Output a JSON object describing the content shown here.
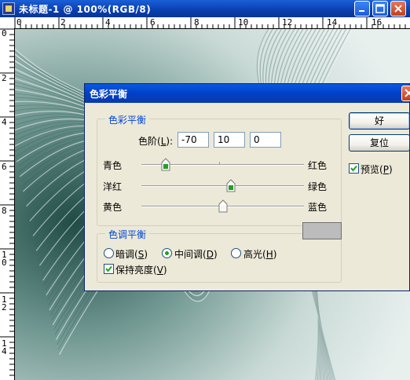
{
  "window": {
    "title": "未标题-1 @ 100%(RGB/8)"
  },
  "rulers": {
    "top": [
      "0",
      "2",
      "4",
      "6",
      "8",
      "10",
      "12",
      "14",
      "16"
    ],
    "left": [
      "0",
      "2",
      "4",
      "6",
      "8",
      "1",
      "0",
      "1",
      "2",
      "1",
      "4"
    ]
  },
  "dialog": {
    "title": "色彩平衡",
    "balance_group": {
      "label": "色彩平衡",
      "levels_label": "色阶(",
      "levels_key": "L",
      "levels_label_end": "):",
      "levels": [
        "-70",
        "10",
        "0"
      ],
      "sliders": [
        {
          "left": "青色",
          "right": "红色",
          "value": -70
        },
        {
          "left": "洋红",
          "right": "绿色",
          "value": 10
        },
        {
          "left": "黄色",
          "right": "蓝色",
          "value": 0
        }
      ]
    },
    "tone_group": {
      "label": "色调平衡",
      "shadows": {
        "text": "暗调(",
        "key": "S",
        "end": ")"
      },
      "midtones": {
        "text": "中间调(",
        "key": "D",
        "end": ")",
        "selected": true
      },
      "highlights": {
        "text": "高光(",
        "key": "H",
        "end": ")"
      },
      "preserve": {
        "text": "保持亮度(",
        "key": "V",
        "end": ")",
        "checked": true
      }
    },
    "ok": "好",
    "reset": "复位",
    "preview": {
      "text": "预览(",
      "key": "P",
      "end": ")",
      "checked": true
    }
  },
  "colors": {
    "titlebar": "#0a3fb0",
    "dialog_bg": "#ece9d8",
    "group_label": "#0046d5",
    "canvas_tint": "#2f5f58"
  }
}
